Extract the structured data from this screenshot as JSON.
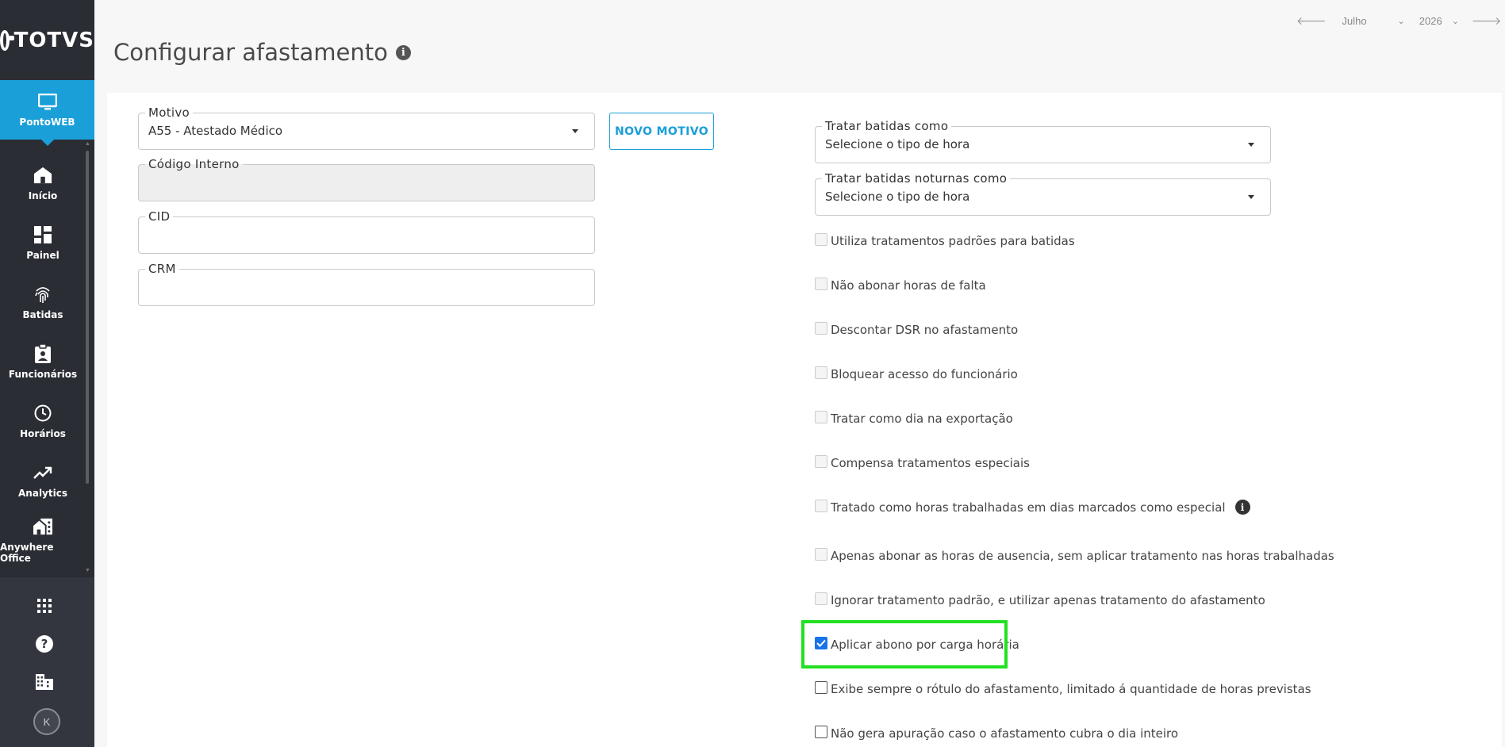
{
  "brand": {
    "name": "TOTVS"
  },
  "sidebar": {
    "active": {
      "label": "PontoWEB",
      "icon": "monitor-icon"
    },
    "items": [
      {
        "label": "Início",
        "icon": "home-icon"
      },
      {
        "label": "Painel",
        "icon": "dashboard-icon"
      },
      {
        "label": "Batidas",
        "icon": "fingerprint-icon"
      },
      {
        "label": "Funcionários",
        "icon": "badge-icon"
      },
      {
        "label": "Horários",
        "icon": "clock-icon"
      },
      {
        "label": "Analytics",
        "icon": "trending-up-icon"
      },
      {
        "label": "Anywhere Office",
        "icon": "home-work-icon"
      }
    ],
    "bottom": [
      "apps-grid-icon",
      "help-icon",
      "building-icon"
    ],
    "avatar_initial": "K"
  },
  "header": {
    "title": "Configurar afastamento",
    "period": {
      "month": "Julho",
      "year": "2026"
    }
  },
  "form": {
    "motivo": {
      "label": "Motivo",
      "value": "A55 - Atestado Médico"
    },
    "codigo_interno": {
      "label": "Código Interno",
      "value": ""
    },
    "cid": {
      "label": "CID",
      "value": ""
    },
    "crm": {
      "label": "CRM",
      "value": ""
    },
    "novo_motivo_button": "NOVO MOTIVO",
    "tratar_batidas": {
      "label": "Tratar batidas como",
      "value": "Selecione o tipo de hora"
    },
    "tratar_batidas_noturnas": {
      "label": "Tratar batidas noturnas como",
      "value": "Selecione o tipo de hora"
    }
  },
  "options": [
    {
      "label": "Utiliza tratamentos padrões para batidas",
      "checked": false,
      "enabled": false
    },
    {
      "label": "Não abonar horas de falta",
      "checked": false,
      "enabled": false
    },
    {
      "label": "Descontar DSR no afastamento",
      "checked": false,
      "enabled": false
    },
    {
      "label": "Bloquear acesso do funcionário",
      "checked": false,
      "enabled": false
    },
    {
      "label": "Tratar como dia na exportação",
      "checked": false,
      "enabled": false
    },
    {
      "label": "Compensa tratamentos especiais",
      "checked": false,
      "enabled": false
    },
    {
      "label": "Tratado como horas trabalhadas em dias marcados como especial",
      "checked": false,
      "enabled": false,
      "info": true
    },
    {
      "label": "Apenas abonar as horas de ausencia, sem aplicar tratamento nas horas trabalhadas",
      "checked": false,
      "enabled": false
    },
    {
      "label": "Ignorar tratamento padrão, e utilizar apenas tratamento do afastamento",
      "checked": false,
      "enabled": false
    },
    {
      "label": "Aplicar abono por carga horária",
      "checked": true,
      "enabled": true
    },
    {
      "label": "Exibe sempre o rótulo do afastamento, limitado á quantidade de horas previstas",
      "checked": false,
      "enabled": true
    },
    {
      "label": "Não gera apuração caso o afastamento cubra o dia inteiro",
      "checked": false,
      "enabled": true
    }
  ],
  "colors": {
    "accent": "#1a9fd8",
    "sidebar": "#2b2d35",
    "highlight": "#22e022",
    "checkbox": "#1a73e8"
  }
}
